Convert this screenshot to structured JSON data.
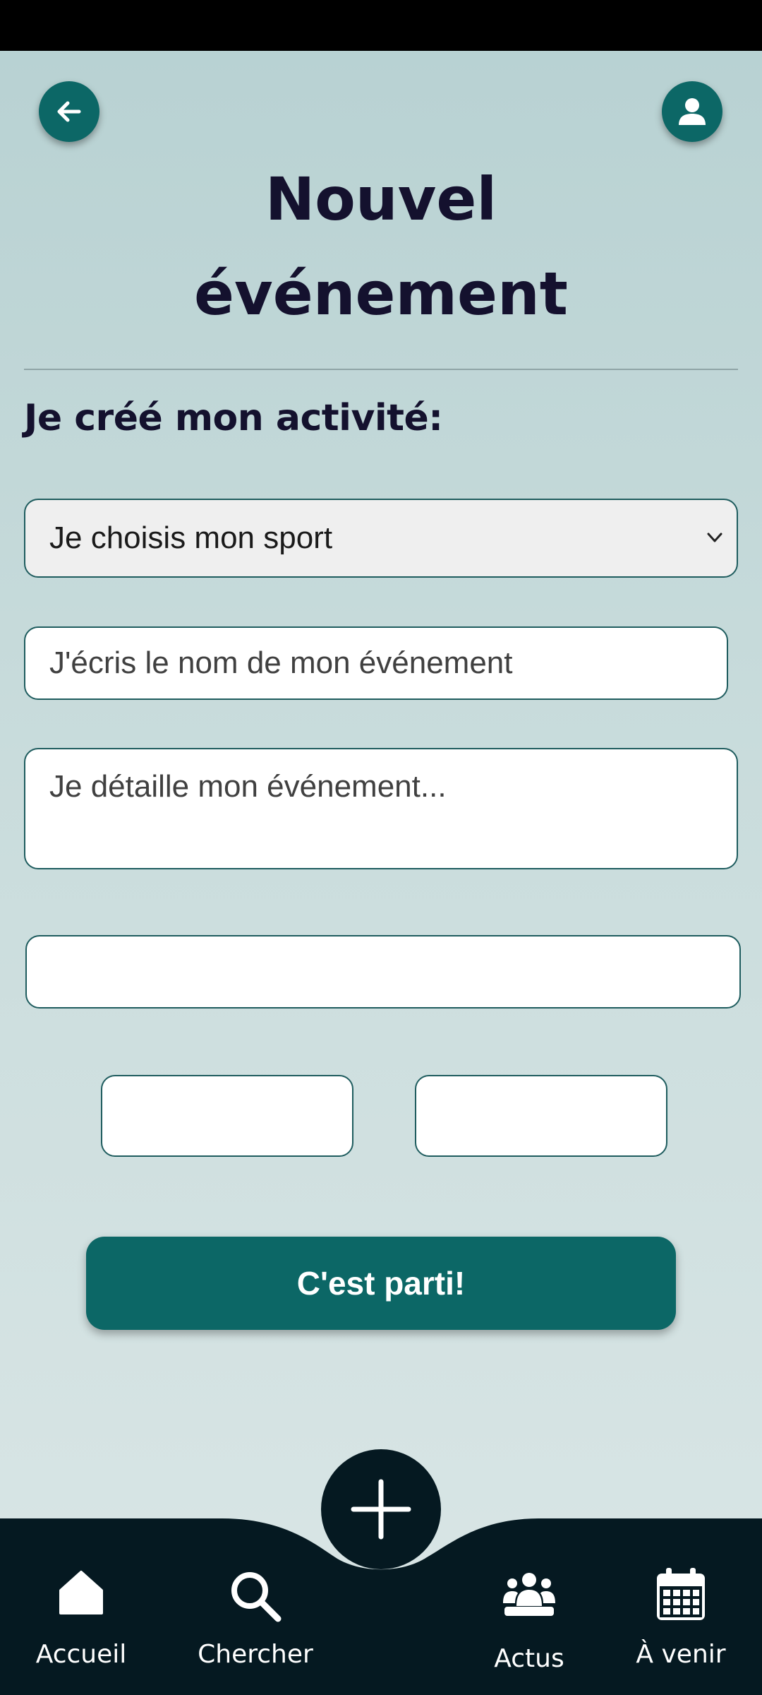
{
  "header": {
    "back_icon": "arrow-left-icon",
    "profile_icon": "user-icon",
    "title_line1": "Nouvel",
    "title_line2": "événement",
    "section_heading": "Je créé mon activité:"
  },
  "form": {
    "sport_select": {
      "selected": "Je choisis mon sport",
      "icon": "chevron-down-icon"
    },
    "name_input": {
      "placeholder": "J'écris le nom de mon événement",
      "value": ""
    },
    "details_input": {
      "placeholder": "Je détaille mon événement...",
      "value": ""
    },
    "location_input": {
      "value": ""
    },
    "date_input": {
      "value": ""
    },
    "time_input": {
      "value": ""
    },
    "submit_label": "C'est parti!"
  },
  "fab": {
    "icon": "plus-icon"
  },
  "nav": {
    "items": [
      {
        "label": "Accueil",
        "icon": "home-icon"
      },
      {
        "label": "Chercher",
        "icon": "search-icon"
      },
      {
        "label": "Actus",
        "icon": "users-icon"
      },
      {
        "label": "À venir",
        "icon": "calendar-icon"
      }
    ]
  },
  "colors": {
    "primary": "#0c6766",
    "nav_background": "#051921",
    "title_text": "#14112e",
    "background_top": "#b7d1d2",
    "background_bottom": "#dae6e6"
  }
}
